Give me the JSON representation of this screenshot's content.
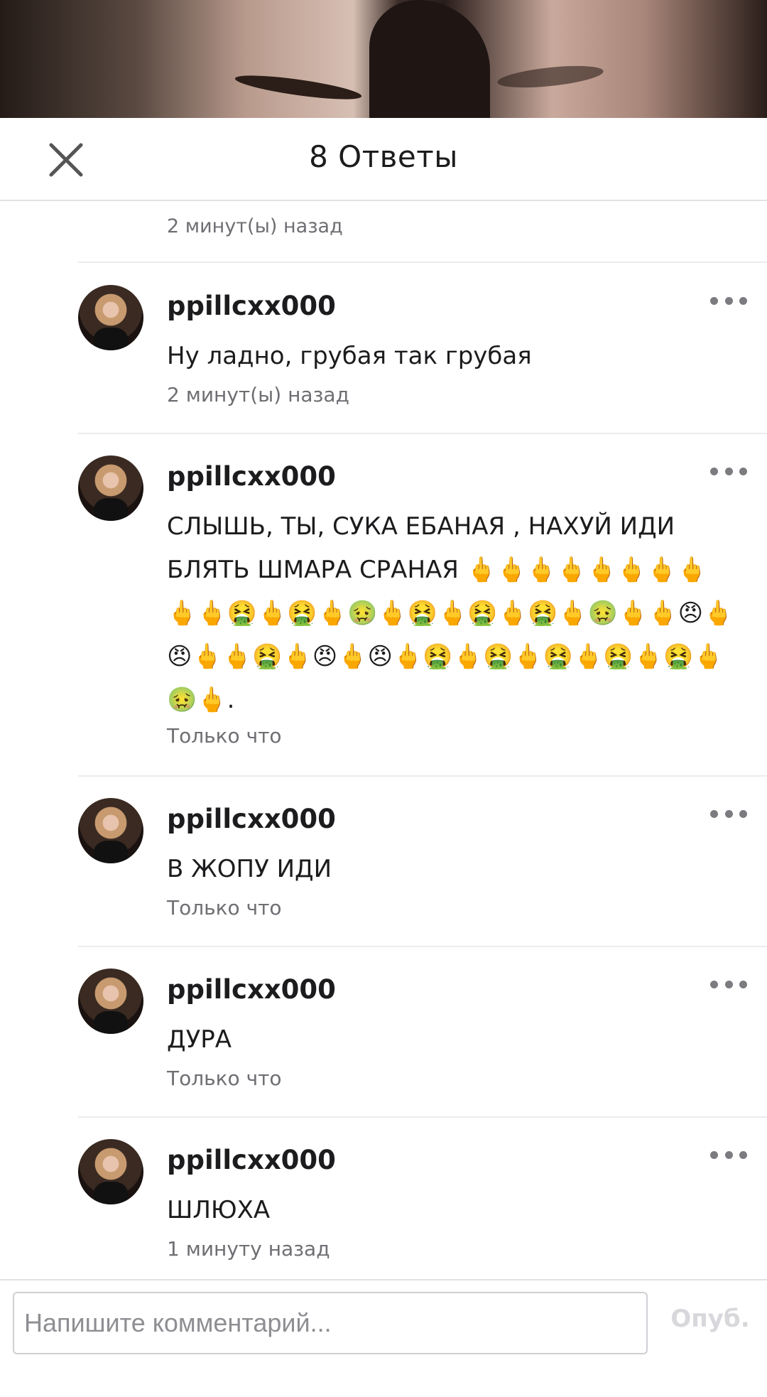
{
  "header": {
    "title": "8 Ответы"
  },
  "previous_comment": {
    "time": "2 минут(ы) назад"
  },
  "comments": [
    {
      "username": "ppillcxx000",
      "text": "Ну ладно, грубая так грубая",
      "time": "2 минут(ы) назад"
    },
    {
      "username": "ppillcxx000",
      "text": "СЛЫШЬ, ТЫ, СУКА ЕБАНАЯ , НАХУЙ ИДИ БЛЯТЬ ШМАРА СРАНАЯ 🖕🖕🖕🖕🖕🖕🖕🖕🖕🖕🤮🖕🤮🖕🤢🖕🤮🖕🤮🖕🤮🖕🤢🖕🖕😠🖕😠🖕🖕🤮🖕😠🖕😠🖕🤮🖕🤮🖕🤮🖕🤮🖕🤮🖕🤢🖕.",
      "time": "Только что"
    },
    {
      "username": "ppillcxx000",
      "text": "В ЖОПУ ИДИ",
      "time": "Только что"
    },
    {
      "username": "ppillcxx000",
      "text": "ДУРА",
      "time": "Только что"
    },
    {
      "username": "ppillcxx000",
      "text": "ШЛЮХА",
      "time": "1 минуту назад"
    }
  ],
  "composer": {
    "placeholder": "Напишите комментарий...",
    "publish_label": "Опуб."
  },
  "icons": {
    "close": "close-icon",
    "more": "more-options-icon"
  }
}
